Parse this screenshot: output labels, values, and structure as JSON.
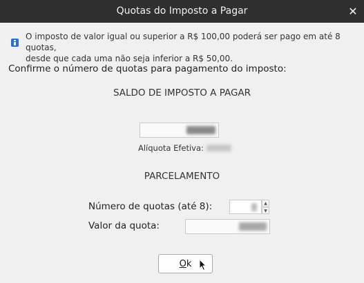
{
  "window": {
    "title": "Quotas do Imposto a Pagar",
    "close_icon": "close-icon"
  },
  "info": {
    "icon": "info-icon",
    "line1": "O imposto de valor igual ou superior a R$ 100,00 poderá ser pago em até 8 quotas,",
    "line2": "desde que cada uma não seja inferior a R$ 50,00."
  },
  "prompt": "Confirme o número de quotas para pagamento do imposto:",
  "saldo": {
    "heading": "SALDO DE IMPOSTO A PAGAR",
    "value_redacted": true
  },
  "aliquota": {
    "label": "Alíquota Efetiva:",
    "value_redacted": true
  },
  "parcelamento": {
    "heading": "PARCELAMENTO",
    "num_quotas_label": "Número de quotas (até 8):",
    "valor_quota_label": "Valor da quota:"
  },
  "ok_button": {
    "mnemonic": "O",
    "rest": "k"
  }
}
